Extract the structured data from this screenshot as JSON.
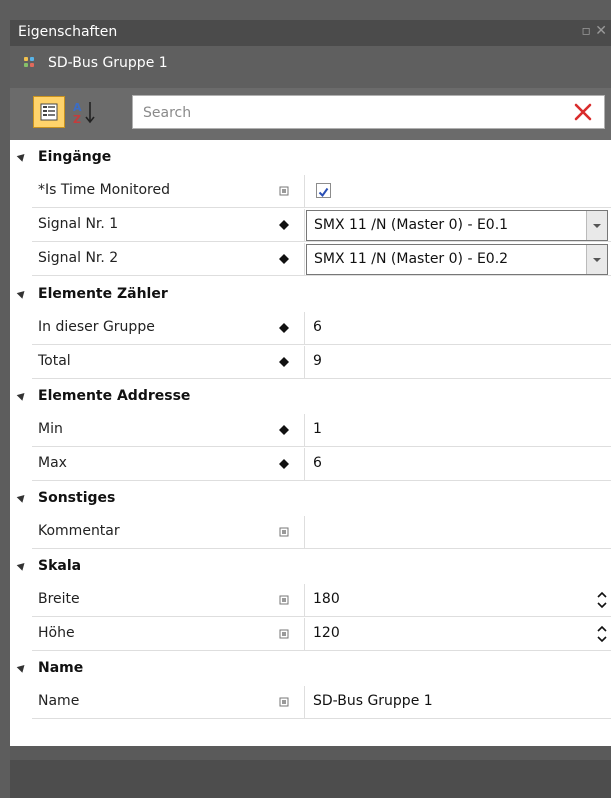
{
  "window": {
    "title": "Eigenschaften",
    "maximize_icon": "maximize-icon",
    "close_icon": "close-icon"
  },
  "object": {
    "name": "SD-Bus Gruppe 1",
    "icon": "group-dots-icon"
  },
  "toolbar": {
    "categorized_icon": "categorized-view-icon",
    "alphabetical_icon": "sort-az-icon",
    "search_placeholder": "Search",
    "clear_icon": "clear-search-icon"
  },
  "grid": {
    "categories": [
      {
        "label": "Eingänge"
      },
      {
        "label": "Elemente Zähler"
      },
      {
        "label": "Elemente Addresse"
      },
      {
        "label": "Sonstiges"
      },
      {
        "label": "Skala"
      },
      {
        "label": "Name"
      }
    ],
    "props": {
      "is_time_monitored": {
        "label": "*Is Time Monitored",
        "checked": true
      },
      "signal1": {
        "label": "Signal Nr. 1",
        "value": "SMX 11 /N (Master 0) - E0.1"
      },
      "signal2": {
        "label": "Signal Nr. 2",
        "value": "SMX 11 /N (Master 0) - E0.2"
      },
      "in_group": {
        "label": "In dieser Gruppe",
        "value": "6"
      },
      "total": {
        "label": "Total",
        "value": "9"
      },
      "min": {
        "label": "Min",
        "value": "1"
      },
      "max": {
        "label": "Max",
        "value": "6"
      },
      "kommentar": {
        "label": "Kommentar",
        "value": ""
      },
      "breite": {
        "label": "Breite",
        "value": "180"
      },
      "hoehe": {
        "label": "Höhe",
        "value": "120"
      },
      "name": {
        "label": "Name",
        "value": "SD-Bus Gruppe 1"
      }
    }
  },
  "colors": {
    "accent_toolbar_button": "#ffd36b",
    "clear_red": "#d92c2c",
    "dot_colors": [
      "#f2c14e",
      "#58b4e8",
      "#86c06a",
      "#e06a5c"
    ]
  }
}
